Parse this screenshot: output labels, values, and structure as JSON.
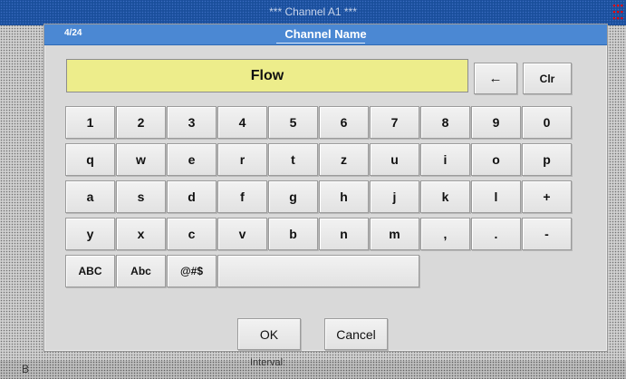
{
  "background": {
    "title": "*** Channel A1 ***",
    "bottom_left": "B",
    "bottom_middle": "Ιnterval:"
  },
  "dialog": {
    "page_indicator": "4/24",
    "title": "Channel Name",
    "input_value": "Flow",
    "backspace_icon": "left-arrow-icon",
    "backspace_symbol": "←",
    "clear_label": "Clr",
    "rows": [
      [
        "1",
        "2",
        "3",
        "4",
        "5",
        "6",
        "7",
        "8",
        "9",
        "0"
      ],
      [
        "q",
        "w",
        "e",
        "r",
        "t",
        "z",
        "u",
        "i",
        "o",
        "p"
      ],
      [
        "a",
        "s",
        "d",
        "f",
        "g",
        "h",
        "j",
        "k",
        "l",
        "+"
      ],
      [
        "y",
        "x",
        "c",
        "v",
        "b",
        "n",
        "m",
        ",",
        ".",
        "-"
      ]
    ],
    "mode_keys": [
      "ABC",
      "Abc",
      "@#$"
    ],
    "space_key": "",
    "ok_label": "OK",
    "cancel_label": "Cancel"
  },
  "colors": {
    "header_blue": "#4b88d3",
    "field_yellow": "#eded8b",
    "background_blue": "#1a4f9c"
  }
}
